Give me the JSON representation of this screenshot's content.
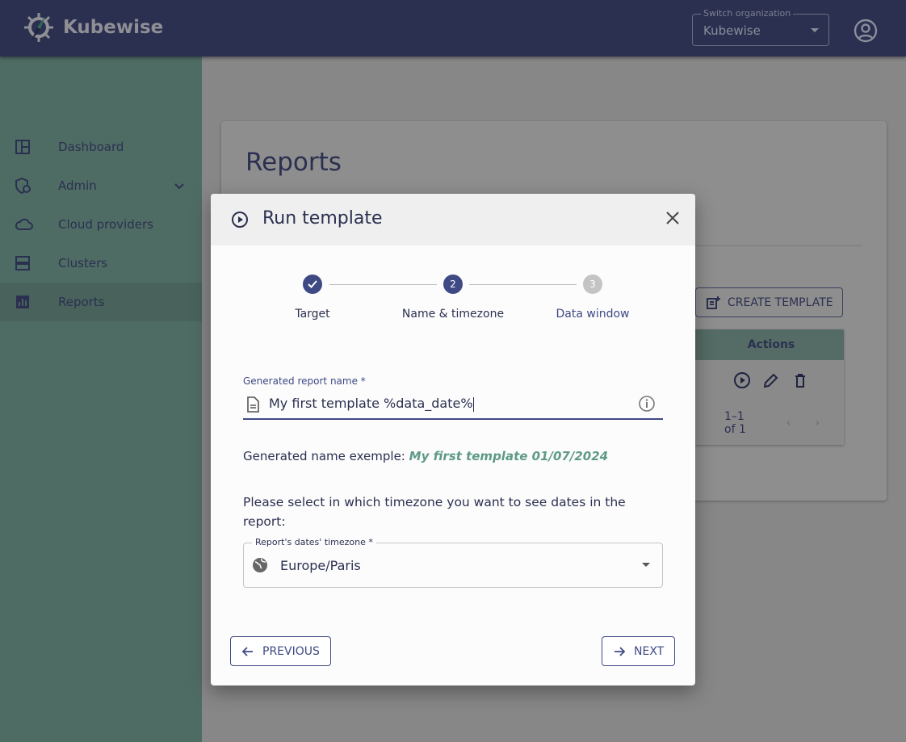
{
  "app": {
    "name": "Kubewise"
  },
  "org": {
    "label": "Switch organization",
    "value": "Kubewise"
  },
  "sidebar": {
    "items": [
      {
        "label": "Dashboard",
        "icon": "dashboard-icon"
      },
      {
        "label": "Admin",
        "icon": "admin-icon"
      },
      {
        "label": "Cloud providers",
        "icon": "cloud-icon"
      },
      {
        "label": "Clusters",
        "icon": "clusters-icon"
      },
      {
        "label": "Reports",
        "icon": "reports-icon",
        "active": true
      }
    ]
  },
  "page": {
    "title": "Reports",
    "create_label": "CREATE TEMPLATE",
    "table": {
      "header": "Actions",
      "pagination": "1–1 of 1"
    }
  },
  "dialog": {
    "title": "Run template",
    "steps": [
      {
        "label": "Target",
        "state": "done"
      },
      {
        "label": "Name & timezone",
        "number": "2",
        "state": "active"
      },
      {
        "label": "Data window",
        "number": "3",
        "state": "pending"
      }
    ],
    "name_field": {
      "label": "Generated report name *",
      "value": "My first template %data_date%"
    },
    "example_prefix": "Generated name exemple:",
    "example_value": "My first template 01/07/2024",
    "timezone_prompt": "Please select in which timezone you want to see dates in the report:",
    "timezone": {
      "label": "Report's dates' timezone *",
      "value": "Europe/Paris"
    },
    "previous_label": "PREVIOUS",
    "next_label": "NEXT"
  },
  "colors": {
    "primary": "#3f4a85",
    "accent": "#5e9a88"
  }
}
